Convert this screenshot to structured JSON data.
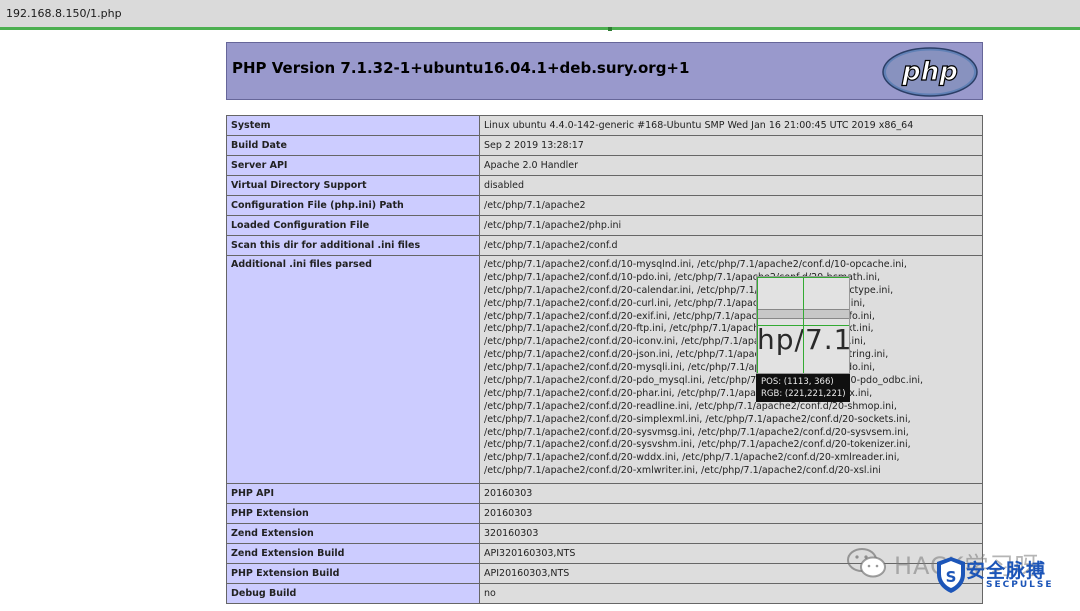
{
  "browser": {
    "url": "192.168.8.150/1.php"
  },
  "header": {
    "title": "PHP Version 7.1.32-1+ubuntu16.04.1+deb.sury.org+1",
    "logo_text": "php"
  },
  "rows_top": [
    {
      "key": "System",
      "value": "Linux ubuntu 4.4.0-142-generic #168-Ubuntu SMP Wed Jan 16 21:00:45 UTC 2019 x86_64"
    },
    {
      "key": "Build Date",
      "value": "Sep 2 2019 13:28:17"
    },
    {
      "key": "Server API",
      "value": "Apache 2.0 Handler"
    },
    {
      "key": "Virtual Directory Support",
      "value": "disabled"
    },
    {
      "key": "Configuration File (php.ini) Path",
      "value": "/etc/php/7.1/apache2"
    },
    {
      "key": "Loaded Configuration File",
      "value": "/etc/php/7.1/apache2/php.ini"
    },
    {
      "key": "Scan this dir for additional .ini files",
      "value": "/etc/php/7.1/apache2/conf.d"
    }
  ],
  "additional": {
    "key": "Additional .ini files parsed",
    "lines": [
      "/etc/php/7.1/apache2/conf.d/10-mysqlnd.ini, /etc/php/7.1/apache2/conf.d/10-opcache.ini,",
      "/etc/php/7.1/apache2/conf.d/10-pdo.ini, /etc/php/7.1/apache2/conf.d/20-bcmath.ini,",
      "/etc/php/7.1/apache2/conf.d/20-calendar.ini, /etc/php/7.1/apache2/conf.d/20-ctype.ini,",
      "/etc/php/7.1/apache2/conf.d/20-curl.ini, /etc/php/7.1/apache2/conf.d/20-dom.ini,",
      "/etc/php/7.1/apache2/conf.d/20-exif.ini, /etc/php/7.1/apache2/conf.d/20-fileinfo.ini,",
      "/etc/php/7.1/apache2/conf.d/20-ftp.ini, /etc/php/7.1/apache2/conf.d/20-gettext.ini,",
      "/etc/php/7.1/apache2/conf.d/20-iconv.ini, /etc/php/7.1/apache2/conf.d/20-intl.ini,",
      "/etc/php/7.1/apache2/conf.d/20-json.ini, /etc/php/7.1/apache2/conf.d/20-mbstring.ini,",
      "/etc/php/7.1/apache2/conf.d/20-mysqli.ini, /etc/php/7.1/apache2/conf.d/20-pdo.ini,",
      "/etc/php/7.1/apache2/conf.d/20-pdo_mysql.ini, /etc/php/7.1/apache2/conf.d/20-pdo_odbc.ini,",
      "/etc/php/7.1/apache2/conf.d/20-phar.ini, /etc/php/7.1/apache2/conf.d/20-posix.ini,",
      "/etc/php/7.1/apache2/conf.d/20-readline.ini, /etc/php/7.1/apache2/conf.d/20-shmop.ini,",
      "/etc/php/7.1/apache2/conf.d/20-simplexml.ini, /etc/php/7.1/apache2/conf.d/20-sockets.ini,",
      "/etc/php/7.1/apache2/conf.d/20-sysvmsg.ini, /etc/php/7.1/apache2/conf.d/20-sysvsem.ini,",
      "/etc/php/7.1/apache2/conf.d/20-sysvshm.ini, /etc/php/7.1/apache2/conf.d/20-tokenizer.ini,",
      "/etc/php/7.1/apache2/conf.d/20-wddx.ini, /etc/php/7.1/apache2/conf.d/20-xmlreader.ini,",
      "/etc/php/7.1/apache2/conf.d/20-xmlwriter.ini, /etc/php/7.1/apache2/conf.d/20-xsl.ini"
    ]
  },
  "rows_bottom": [
    {
      "key": "PHP API",
      "value": "20160303"
    },
    {
      "key": "PHP Extension",
      "value": "20160303"
    },
    {
      "key": "Zend Extension",
      "value": "320160303"
    },
    {
      "key": "Zend Extension Build",
      "value": "API320160303,NTS"
    },
    {
      "key": "PHP Extension Build",
      "value": "API20160303,NTS"
    },
    {
      "key": "Debug Build",
      "value": "no"
    }
  ],
  "picker": {
    "zoom_text": "hp/7.1/",
    "pos": "POS:  (1113, 366)",
    "rgb": "RGB:  (221,221,221)"
  },
  "watermark": {
    "text": "HACK学习呀",
    "brand_cn": "安全脉搏",
    "brand_en": "SECPULSE",
    "shield_letter": "S"
  },
  "colors": {
    "header_bg": "#9999cc",
    "key_bg": "#ccccff",
    "value_bg": "#dddddd",
    "progress": "#4caf50",
    "brand": "#1c55b8"
  }
}
